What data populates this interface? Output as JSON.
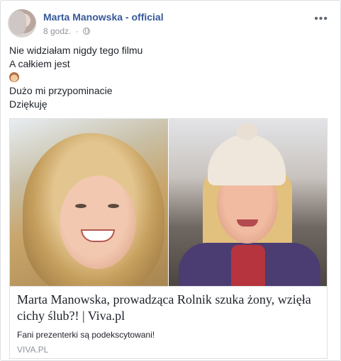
{
  "post": {
    "page_name": "Marta Manowska - official",
    "timestamp": "8 godz.",
    "privacy_separator": "·",
    "text_lines": [
      "Nie widziałam nigdy tego filmu",
      "A całkiem jest",
      "Dużo mi przypominacie",
      "Dziękuję"
    ]
  },
  "icons": {
    "more": "more-options-icon",
    "privacy": "globe-icon",
    "emoji": "emoji-icon"
  },
  "link_preview": {
    "title": "Marta Manowska, prowadząca Rolnik szuka żony, wzięła cichy ślub?! | Viva.pl",
    "description": "Fani prezenterki są podekscytowani!",
    "domain": "VIVA.PL"
  },
  "colors": {
    "page_name": "#365899",
    "meta_text": "#90949c",
    "body_text": "#1d2129",
    "border": "#dddfe2"
  }
}
